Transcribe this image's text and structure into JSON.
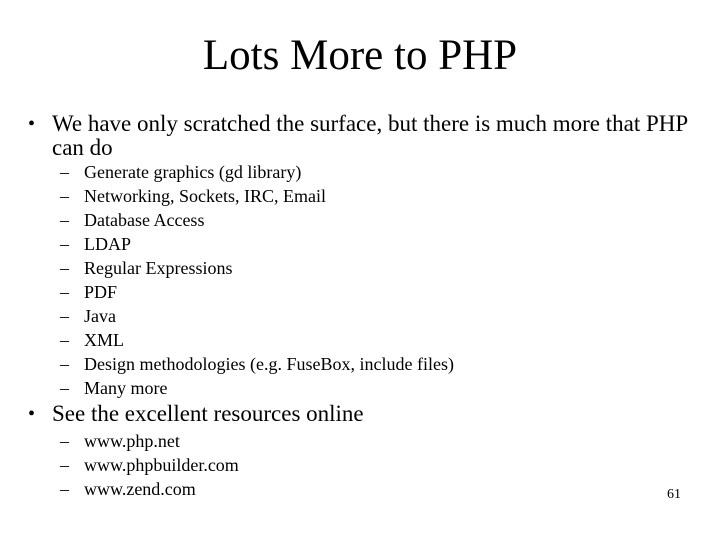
{
  "slide": {
    "title": "Lots More to PHP",
    "bullets": [
      {
        "marker": "•",
        "text": "We have only scratched the surface, but there is much more that PHP can do",
        "subitems": [
          "Generate graphics (gd library)",
          "Networking, Sockets, IRC, Email",
          "Database Access",
          "LDAP",
          "Regular Expressions",
          "PDF",
          "Java",
          "XML",
          "Design methodologies (e.g. FuseBox, include files)",
          "Many more"
        ]
      },
      {
        "marker": "•",
        "text": "See the excellent resources online",
        "subitems": [
          "www.php.net",
          "www.phpbuilder.com",
          "www.zend.com"
        ]
      }
    ],
    "sub_marker": "–",
    "page_number": "61"
  }
}
